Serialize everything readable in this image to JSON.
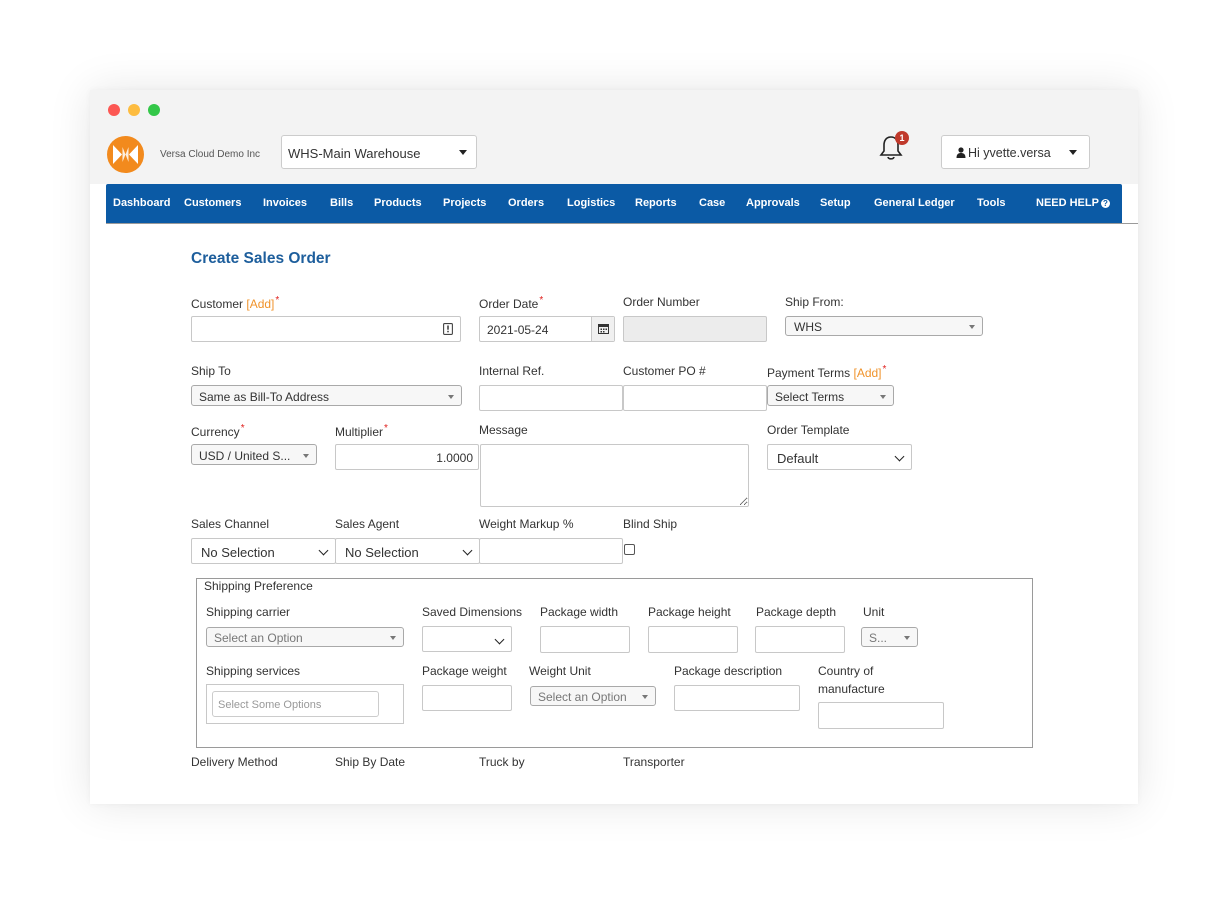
{
  "window": {
    "controls": [
      "close",
      "minimize",
      "maximize"
    ]
  },
  "header": {
    "company_name": "Versa Cloud Demo Inc",
    "warehouse": "WHS-Main Warehouse",
    "notification_count": "1",
    "user_greeting": "Hi yvette.versa"
  },
  "nav": {
    "items": [
      "Dashboard",
      "Customers",
      "Invoices",
      "Bills",
      "Products",
      "Projects",
      "Orders",
      "Logistics",
      "Reports",
      "Case",
      "Approvals",
      "Setup",
      "General Ledger",
      "Tools",
      "NEED HELP"
    ],
    "color": "#0b5aa5"
  },
  "form": {
    "title": "Create Sales Order",
    "customer": {
      "label": "Customer",
      "add_link": "[Add]",
      "value": ""
    },
    "order_date": {
      "label": "Order Date",
      "value": "2021-05-24"
    },
    "order_number": {
      "label": "Order Number",
      "value": ""
    },
    "ship_from": {
      "label": "Ship From:",
      "value": "WHS"
    },
    "ship_to": {
      "label": "Ship To",
      "value": "Same as Bill-To Address"
    },
    "internal_ref": {
      "label": "Internal Ref.",
      "value": ""
    },
    "customer_po": {
      "label": "Customer PO #",
      "value": ""
    },
    "payment_terms": {
      "label": "Payment Terms",
      "add_link": "[Add]",
      "value": "Select Terms"
    },
    "currency": {
      "label": "Currency",
      "value": "USD / United S..."
    },
    "multiplier": {
      "label": "Multiplier",
      "value": "1.0000"
    },
    "message": {
      "label": "Message",
      "value": ""
    },
    "order_template": {
      "label": "Order Template",
      "value": "Default"
    },
    "sales_channel": {
      "label": "Sales Channel",
      "value": "No Selection"
    },
    "sales_agent": {
      "label": "Sales Agent",
      "value": "No Selection"
    },
    "weight_markup": {
      "label": "Weight Markup %",
      "value": ""
    },
    "blind_ship": {
      "label": "Blind Ship",
      "checked": false
    },
    "required_marker": "*"
  },
  "shipping": {
    "legend": "Shipping Preference",
    "carrier": {
      "label": "Shipping carrier",
      "placeholder": "Select an Option"
    },
    "saved_dimensions": {
      "label": "Saved Dimensions",
      "value": ""
    },
    "package_width": {
      "label": "Package width",
      "value": ""
    },
    "package_height": {
      "label": "Package height",
      "value": ""
    },
    "package_depth": {
      "label": "Package depth",
      "value": ""
    },
    "unit": {
      "label": "Unit",
      "value": "S..."
    },
    "services": {
      "label": "Shipping services",
      "placeholder": "Select Some Options"
    },
    "package_weight": {
      "label": "Package weight",
      "value": ""
    },
    "weight_unit": {
      "label": "Weight Unit",
      "placeholder": "Select an Option"
    },
    "package_description": {
      "label": "Package description",
      "value": ""
    },
    "country": {
      "label_line1": "Country of",
      "label_line2": "manufacture",
      "value": ""
    }
  },
  "footer_fields": {
    "delivery_method": "Delivery Method",
    "ship_by_date": "Ship By Date",
    "truck_by": "Truck by",
    "transporter": "Transporter"
  }
}
